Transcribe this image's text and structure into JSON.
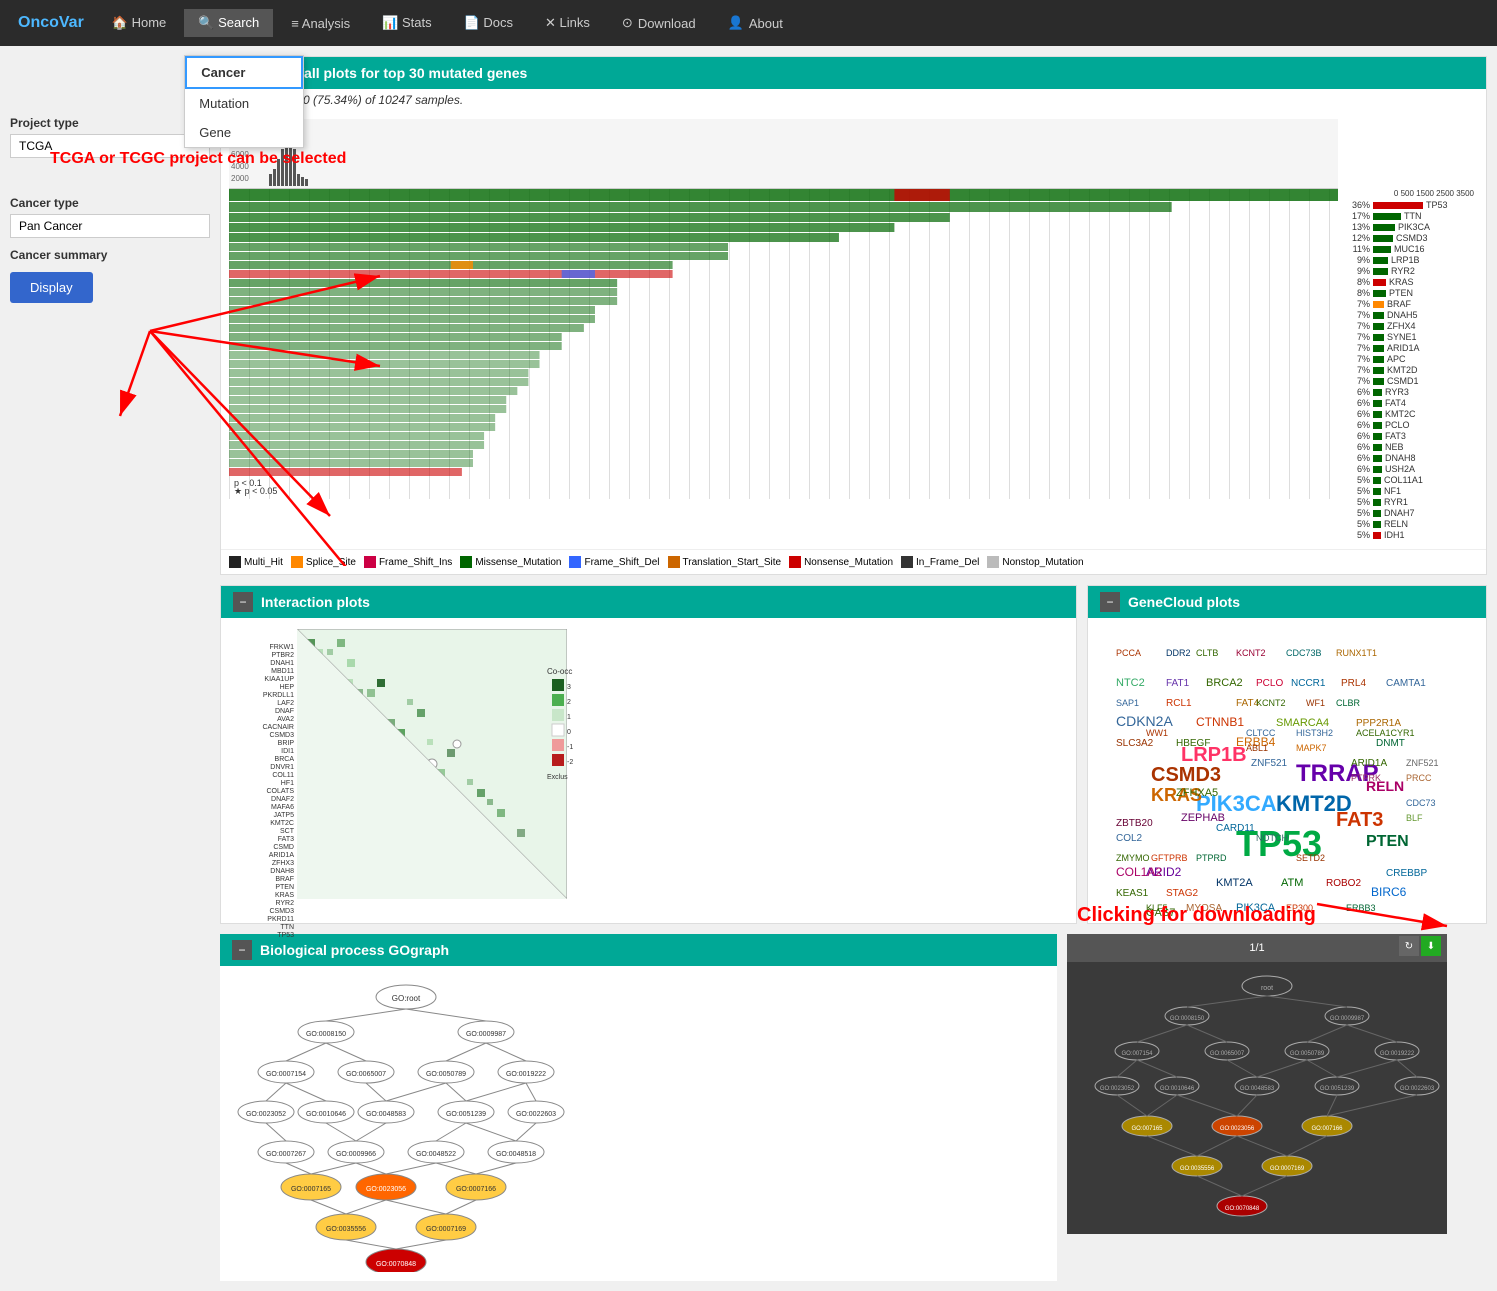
{
  "navbar": {
    "brand": "OncoVar",
    "items": [
      {
        "label": "Home",
        "icon": "🏠",
        "active": false
      },
      {
        "label": "Search",
        "icon": "🔍",
        "active": true
      },
      {
        "label": "Analysis",
        "icon": "≡",
        "active": false
      },
      {
        "label": "Stats",
        "icon": "📊",
        "active": false
      },
      {
        "label": "Docs",
        "icon": "📄",
        "active": false
      },
      {
        "label": "Links",
        "icon": "✕",
        "active": false
      },
      {
        "label": "Download",
        "icon": "⊙",
        "active": false
      },
      {
        "label": "About",
        "icon": "👤",
        "active": false
      }
    ]
  },
  "dropdown": {
    "items": [
      "Cancer",
      "Mutation",
      "Gene"
    ],
    "selected": "Cancer"
  },
  "form": {
    "project_type_label": "Project type",
    "project_type_value": "TCGA",
    "cancer_type_label": "Cancer type",
    "cancer_type_value": "Pan Cancer",
    "cancer_summary_label": "Cancer summary",
    "display_btn": "Display"
  },
  "annotation": {
    "tcga_text": "TCGA or TCGC project can be selected"
  },
  "waterfall": {
    "header": "Waterfall plots for top 30 mutated genes",
    "subtitle": "Altered in 7720 (75.34%) of 10247 samples.",
    "genes": [
      {
        "name": "TP53",
        "pct": "36%",
        "color": "red"
      },
      {
        "name": "TTN",
        "pct": "17%",
        "color": "green"
      },
      {
        "name": "PIK3CA",
        "pct": "13%",
        "color": "green"
      },
      {
        "name": "CSMD3",
        "pct": "12%",
        "color": "green"
      },
      {
        "name": "MUC16",
        "pct": "11%",
        "color": "green"
      },
      {
        "name": "LRP1B",
        "pct": "9%",
        "color": "green"
      },
      {
        "name": "RYR2",
        "pct": "9%",
        "color": "green"
      },
      {
        "name": "KRAS",
        "pct": "8%",
        "color": "red"
      },
      {
        "name": "PTEN",
        "pct": "8%",
        "color": "green"
      },
      {
        "name": "BRAF",
        "pct": "7%",
        "color": "orange"
      },
      {
        "name": "DNAH5",
        "pct": "7%",
        "color": "green"
      },
      {
        "name": "ZFHX4",
        "pct": "7%",
        "color": "green"
      },
      {
        "name": "SYNE1",
        "pct": "7%",
        "color": "green"
      },
      {
        "name": "ARID1A",
        "pct": "7%",
        "color": "green"
      },
      {
        "name": "APC",
        "pct": "7%",
        "color": "green"
      },
      {
        "name": "KMT2D",
        "pct": "7%",
        "color": "green"
      },
      {
        "name": "CSMD1",
        "pct": "7%",
        "color": "green"
      },
      {
        "name": "RYR3",
        "pct": "6%",
        "color": "green"
      },
      {
        "name": "FAT4",
        "pct": "6%",
        "color": "green"
      },
      {
        "name": "KMT2C",
        "pct": "6%",
        "color": "green"
      },
      {
        "name": "PCLO",
        "pct": "6%",
        "color": "green"
      },
      {
        "name": "FAT3",
        "pct": "6%",
        "color": "green"
      },
      {
        "name": "NEB",
        "pct": "6%",
        "color": "green"
      },
      {
        "name": "DNAH8",
        "pct": "6%",
        "color": "green"
      },
      {
        "name": "USH2A",
        "pct": "6%",
        "color": "green"
      },
      {
        "name": "COL11A1",
        "pct": "5%",
        "color": "green"
      },
      {
        "name": "NF1",
        "pct": "5%",
        "color": "green"
      },
      {
        "name": "RYR1",
        "pct": "5%",
        "color": "green"
      },
      {
        "name": "DNAH7",
        "pct": "5%",
        "color": "green"
      },
      {
        "name": "RELN",
        "pct": "5%",
        "color": "green"
      },
      {
        "name": "IDH1",
        "pct": "5%",
        "color": "red"
      }
    ]
  },
  "interaction": {
    "header": "Interaction plots"
  },
  "genecloud": {
    "header": "GeneCloud plots"
  },
  "biological": {
    "header": "Biological process GOgraph"
  },
  "legend": {
    "items": [
      {
        "label": "Multi_Hit",
        "color": "#222222"
      },
      {
        "label": "Splice_Site",
        "color": "#ff8800"
      },
      {
        "label": "Frame_Shift_Ins",
        "color": "#cc0044"
      },
      {
        "label": "Missense_Mutation",
        "color": "#006600"
      },
      {
        "label": "Frame_Shift_Del",
        "color": "#3366ff"
      },
      {
        "label": "Translation_Start_Site",
        "color": "#cc6600"
      },
      {
        "label": "Nonsense_Mutation",
        "color": "#cc0000"
      },
      {
        "label": "In_Frame_Del",
        "color": "#333333"
      },
      {
        "label": "Nonstop_Mutation",
        "color": "#bbbbbb"
      }
    ]
  },
  "clicking_text": "Clicking for downloading",
  "viewer": {
    "page_info": "1/1"
  }
}
